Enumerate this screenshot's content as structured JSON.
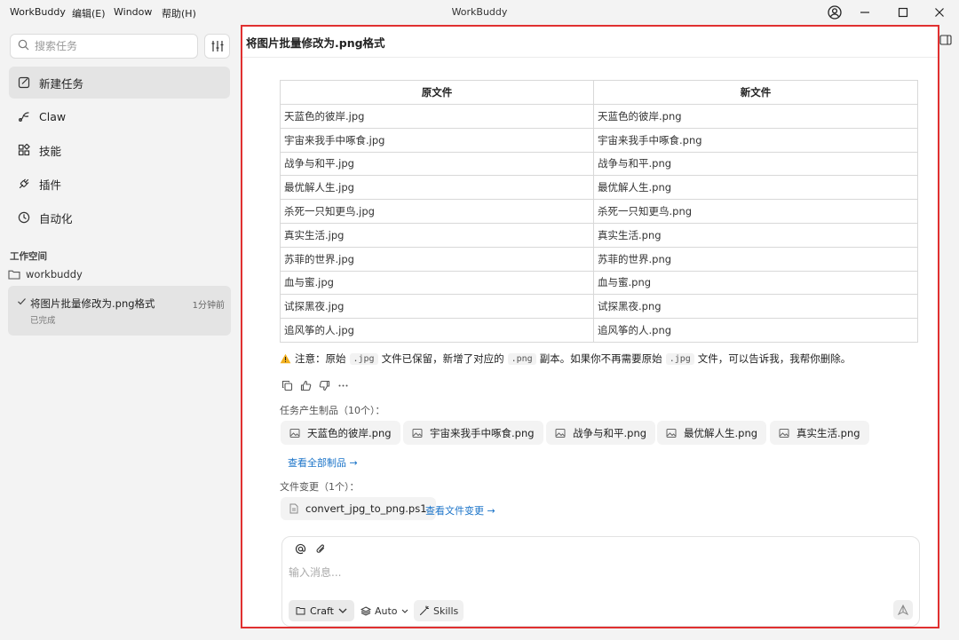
{
  "window": {
    "title": "WorkBuddy",
    "menu": [
      "WorkBuddy",
      "编辑(E)",
      "Window",
      "帮助(H)"
    ]
  },
  "sidebar": {
    "search_placeholder": "搜索任务",
    "nav": [
      {
        "label": "新建任务",
        "icon": "new-task-icon"
      },
      {
        "label": "Claw",
        "icon": "claw-icon"
      },
      {
        "label": "技能",
        "icon": "skills-icon"
      },
      {
        "label": "插件",
        "icon": "plugin-icon"
      },
      {
        "label": "自动化",
        "icon": "clock-icon"
      }
    ],
    "workspace_header": "工作空间",
    "workspace_folder": "workbuddy",
    "task": {
      "title": "将图片批量修改为.png格式",
      "time": "1分钟前",
      "status": "已完成"
    }
  },
  "main": {
    "title": "将图片批量修改为.png格式",
    "table": {
      "headers": [
        "原文件",
        "新文件"
      ],
      "rows": [
        [
          "天蓝色的彼岸.jpg",
          "天蓝色的彼岸.png"
        ],
        [
          "宇宙来我手中啄食.jpg",
          "宇宙来我手中啄食.png"
        ],
        [
          "战争与和平.jpg",
          "战争与和平.png"
        ],
        [
          "最优解人生.jpg",
          "最优解人生.png"
        ],
        [
          "杀死一只知更鸟.jpg",
          "杀死一只知更鸟.png"
        ],
        [
          "真实生活.jpg",
          "真实生活.png"
        ],
        [
          "苏菲的世界.jpg",
          "苏菲的世界.png"
        ],
        [
          "血与蜜.jpg",
          "血与蜜.png"
        ],
        [
          "试探黑夜.jpg",
          "试探黑夜.png"
        ],
        [
          "追风筝的人.jpg",
          "追风筝的人.png"
        ]
      ]
    },
    "note": {
      "prefix": "注意：原始",
      "code1": ".jpg",
      "mid1": "文件已保留，新增了对应的",
      "code2": ".png",
      "mid2": "副本。如果你不再需要原始",
      "code3": ".jpg",
      "suffix": "文件，可以告诉我，我帮你删除。"
    },
    "artifacts_label": "任务产生制品（10个）：",
    "artifacts": [
      "天蓝色的彼岸.png",
      "宇宙来我手中啄食.png",
      "战争与和平.png",
      "最优解人生.png",
      "真实生活.png"
    ],
    "view_all_artifacts": "查看全部制品 →",
    "changes_label": "文件变更（1个）：",
    "change_file": "convert_jpg_to_png.ps1",
    "view_changes": "查看文件变更 →"
  },
  "composer": {
    "placeholder": "输入消息...",
    "craft_label": "Craft",
    "auto_label": "Auto",
    "skills_label": "Skills"
  }
}
